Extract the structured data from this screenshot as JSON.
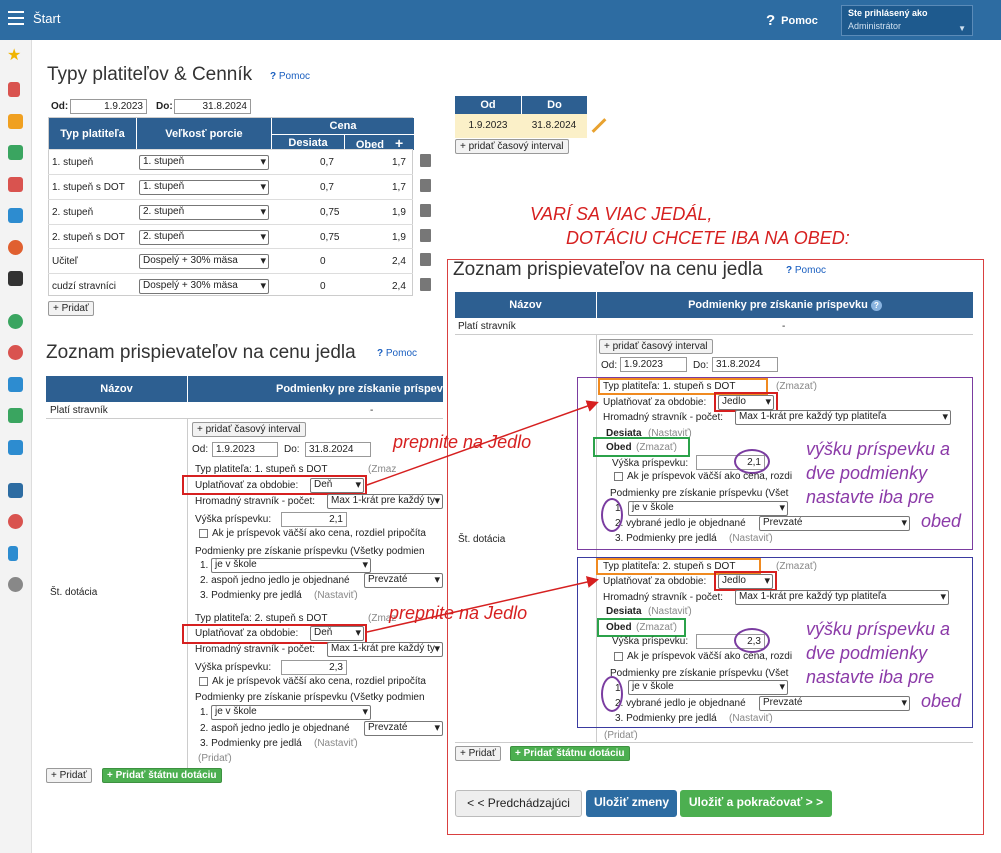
{
  "topbar": {
    "title": "Štart",
    "help": "Pomoc",
    "user_line1": "Ste prihlásený ako",
    "user_line2": "Administrátor"
  },
  "page": {
    "title": "Typy platiteľov & Cenník",
    "help": "Pomoc"
  },
  "dates": {
    "od_label": "Od:",
    "od": "1.9.2023",
    "do_label": "Do:",
    "do": "31.8.2024"
  },
  "price_table": {
    "h_typ": "Typ platiteľa",
    "h_porcia": "Veľkosť porcie",
    "h_cena": "Cena",
    "h_desiata": "Desiata",
    "h_obed": "Obed",
    "rows": [
      {
        "typ": "1. stupeň",
        "porcia": "1. stupeň",
        "desiata": "0,7",
        "obed": "1,7"
      },
      {
        "typ": "1. stupeň  s DOT",
        "porcia": "1. stupeň",
        "desiata": "0,7",
        "obed": "1,7"
      },
      {
        "typ": "2. stupeň",
        "porcia": "2. stupeň",
        "desiata": "0,75",
        "obed": "1,9"
      },
      {
        "typ": "2. stupeň  s DOT",
        "porcia": "2. stupeň",
        "desiata": "0,75",
        "obed": "1,9"
      },
      {
        "typ": "Učiteľ",
        "porcia": "Dospelý + 30% mäsa",
        "desiata": "0",
        "obed": "2,4"
      },
      {
        "typ": "cudzí stravníci",
        "porcia": "Dospelý + 30% mäsa",
        "desiata": "0",
        "obed": "2,4"
      }
    ],
    "add": "+ Pridať"
  },
  "interval": {
    "h_od": "Od",
    "h_do": "Do",
    "od": "1.9.2023",
    "do": "31.8.2024",
    "add": "+ pridať časový interval"
  },
  "left": {
    "title": "Zoznam prispievateľov na cenu jedla",
    "help": "Pomoc",
    "h_nazov": "Názov",
    "h_podm": "Podmienky pre získanie príspevk",
    "row1": "Platí stravník",
    "row1_val": "-",
    "row2": "Št. dotácia",
    "add_int": "+ pridať časový interval",
    "od": "1.9.2023",
    "do": "31.8.2024",
    "b1_typ": "Typ platiteľa: 1. stupeň  s DOT",
    "zmazat": "(Zmaz",
    "uplat": "Uplatňovať za obdobie:",
    "den": "Deň",
    "hrom": "Hromadný stravník - počet:",
    "hrom_val": "Max 1-krát pre každý ty",
    "vyska": "Výška príspevku:",
    "vyska1": "2,1",
    "chk": "Ak je príspevok väčší ako cena, rozdiel pripočíta",
    "podm": "Podmienky pre získanie príspevku (Všetky podmien",
    "c1": "1.",
    "c1v": "je v škole",
    "c2": "2. aspoň jedno jedlo je objednané",
    "c2v": "Prevzaté",
    "c3": "3. Podmienky pre jedlá",
    "nast": "(Nastaviť)",
    "b2_typ": "Typ platiteľa: 2. stupeň  s DOT",
    "vyska2": "2,3",
    "pridat_sm": "(Pridať)",
    "add": "+ Pridať",
    "add_state": "+ Pridať štátnu dotáciu"
  },
  "ann": {
    "red_top1": "VARÍ SA VIAC JEDÁL,",
    "red_top2": "DOTÁCIU CHCETE IBA NA OBED:",
    "jedlo1": "prepnite na Jedlo",
    "jedlo2": "prepnite na Jedlo",
    "p1": "výšku príspevku a",
    "p2": "dve podmienky",
    "p3": "nastavte iba pre",
    "p4": "obed"
  },
  "right": {
    "title": "Zoznam prispievateľov na cenu jedla",
    "help": "Pomoc",
    "h_nazov": "Názov",
    "h_podm": "Podmienky pre získanie príspevku",
    "row1": "Platí stravník",
    "row1_val": "-",
    "row2": "Št. dotácia",
    "add_int": "+ pridať časový interval",
    "od": "1.9.2023",
    "do": "31.8.2024",
    "b1_typ": "Typ platiteľa: 1. stupeň  s DOT",
    "zmazat": "(Zmazať)",
    "uplat": "Uplatňovať za obdobie:",
    "jedlo": "Jedlo",
    "hrom": "Hromadný stravník - počet:",
    "hrom_val": "Max 1-krát pre každý typ platiteľa",
    "desiata": "Desiata",
    "nast": "(Nastaviť)",
    "obed": "Obed",
    "zmaz2": "(Zmazať)",
    "vyska": "Výška príspevku:",
    "v1": "2,1",
    "chk": "Ak je príspevok väčší ako cena, rozdi",
    "podm": "Podmienky pre získanie príspevku (Všet",
    "c1": "1.",
    "c1v": "je v škole",
    "c2": "2. vybrané jedlo je objednané",
    "c2v": "Prevzaté",
    "c3": "3. Podmienky pre jedlá",
    "b2_typ": "Typ platiteľa: 2. stupeň  s DOT",
    "v2": "2,3",
    "pridat_sm": "(Pridať)",
    "add": "+ Pridať",
    "add_state": "+ Pridať štátnu dotáciu",
    "prev": "< < Predchádzajúci",
    "save": "Uložiť zmeny",
    "save_next": "Uložiť a pokračovať > >"
  }
}
